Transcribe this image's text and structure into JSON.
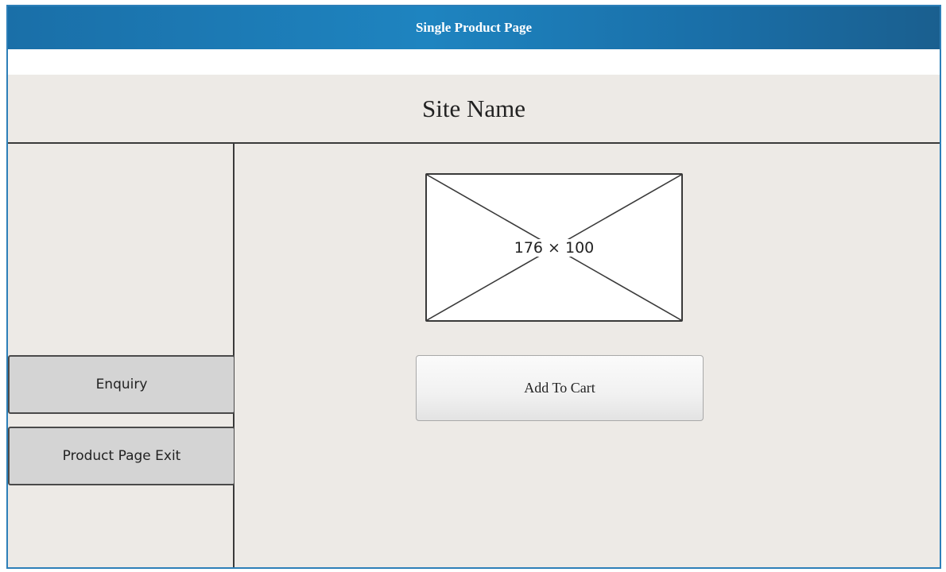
{
  "window": {
    "title": "Single Product Page"
  },
  "header": {
    "site_name": "Site Name"
  },
  "sidebar": {
    "enquiry_label": "Enquiry",
    "exit_label": "Product Page Exit"
  },
  "product": {
    "image_placeholder": "176 × 100",
    "add_to_cart_label": "Add To Cart"
  },
  "colors": {
    "titlebar": "#1e84c0",
    "panel_background": "#edeae6",
    "sidebar_button": "#d4d4d4"
  }
}
